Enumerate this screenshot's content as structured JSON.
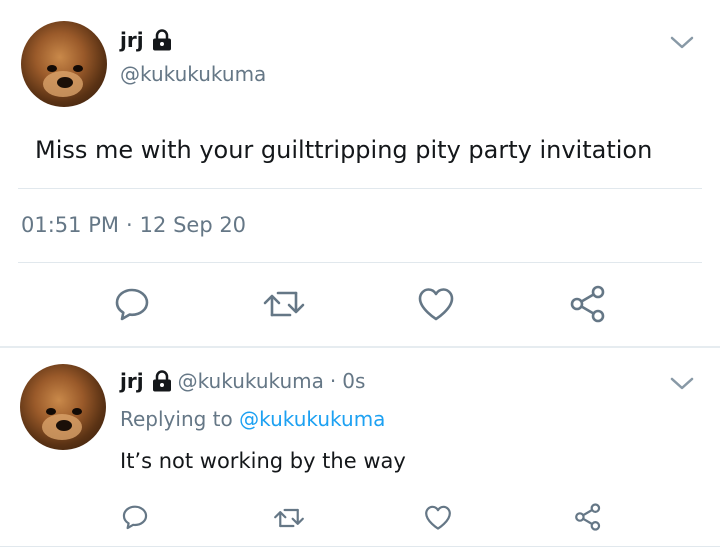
{
  "tweet": {
    "display_name": "jrj",
    "username": "@kukukukuma",
    "text": "Miss me with your guilttripping pity party invitation",
    "time": "01:51 PM",
    "separator": "·",
    "date": "12 Sep 20",
    "actions": [
      "reply-icon",
      "retweet-icon",
      "like-icon",
      "share-icon"
    ]
  },
  "reply": {
    "display_name": "jrj",
    "username": "@kukukukuma",
    "separator": "·",
    "age": "0s",
    "replying_prefix": "Replying to",
    "replying_handle": "@kukukukuma",
    "text": "It’s not working by the way",
    "actions": [
      "reply-icon",
      "retweet-icon",
      "like-icon",
      "share-icon"
    ]
  },
  "colors": {
    "text": "#14171a",
    "secondary": "#657786",
    "link": "#1da1f2",
    "divider": "#e1e8ed"
  }
}
